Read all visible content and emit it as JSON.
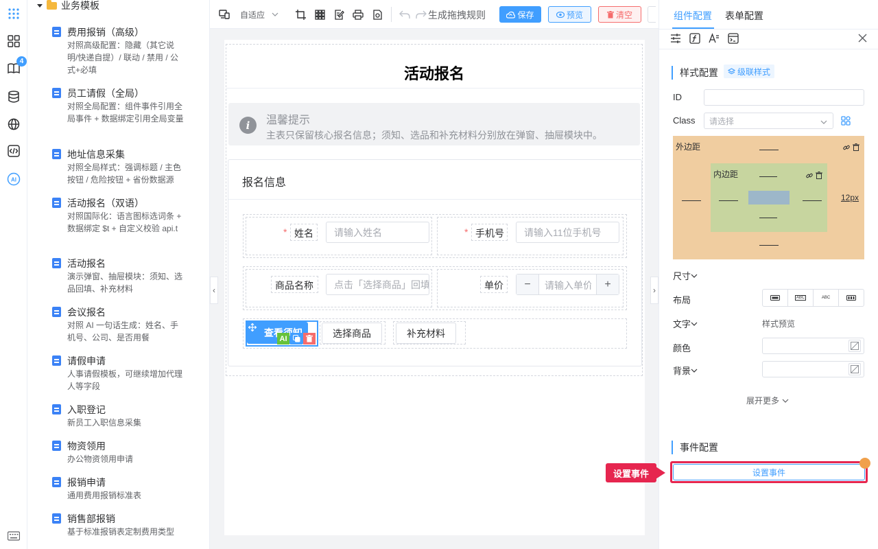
{
  "rail": {
    "icons": [
      "apps-grid-icon",
      "book-icon",
      "database-icon",
      "globe-icon",
      "code-icon",
      "ai-icon",
      "keyboard-icon"
    ],
    "badge": "4"
  },
  "templates": {
    "folder": "业务模板",
    "items": [
      {
        "title": "费用报销（高级）",
        "desc": "对照高级配置：隐藏（其它说明/快递自提）/ 联动 / 禁用 / 公式+必填"
      },
      {
        "title": "员工请假（全局）",
        "desc": "对照全局配置：组件事件引用全局事件 + 数据绑定引用全局变量"
      },
      {
        "title": "地址信息采集",
        "desc": "对照全局样式：强调标题 / 主色按钮 / 危险按钮 + 省份数据源"
      },
      {
        "title": "活动报名（双语）",
        "desc": "对照国际化：语言图标选词条 + 数据绑定 $t + 自定义校验 api.t"
      },
      {
        "title": "活动报名",
        "desc": "演示弹窗、抽屉模块：须知、选品回填、补充材料"
      },
      {
        "title": "会议报名",
        "desc": "对照 AI 一句话生成：姓名、手机号、公司、是否用餐"
      },
      {
        "title": "请假申请",
        "desc": "人事请假模板，可继续增加代理人等字段"
      },
      {
        "title": "入职登记",
        "desc": "新员工入职信息采集"
      },
      {
        "title": "物资领用",
        "desc": "办公物资领用申请"
      },
      {
        "title": "报销申请",
        "desc": "通用费用报销标准表"
      },
      {
        "title": "销售部报销",
        "desc": "基于标准报销表定制费用类型"
      }
    ]
  },
  "toolbar": {
    "adaptive": "自适应",
    "drag_rule": "生成拖拽规则",
    "save": "保存",
    "preview": "预览",
    "clear": "清空"
  },
  "form": {
    "title": "活动报名",
    "tip_title": "温馨提示",
    "tip_text": "主表只保留核心报名信息；须知、选品和补充材料分别放在弹窗、抽屉模块中。",
    "section": "报名信息",
    "name_label": "姓名",
    "name_placeholder": "请输入姓名",
    "phone_label": "手机号",
    "phone_placeholder": "请输入11位手机号",
    "product_label": "商品名称",
    "product_placeholder": "点击「选择商品」回填",
    "price_label": "单价",
    "price_placeholder": "请输入单价",
    "btn_notice": "查看须知",
    "btn_select": "选择商品",
    "btn_material": "补充材料",
    "minus": "−",
    "plus": "+",
    "ai": "AI"
  },
  "panel": {
    "tab_component": "组件配置",
    "tab_form": "表单配置",
    "style_title": "样式配置",
    "cascade": "级联样式",
    "id_label": "ID",
    "class_label": "Class",
    "class_placeholder": "请选择",
    "margin_label": "外边距",
    "padding_label": "内边距",
    "margin_right_value": "12px",
    "size_label": "尺寸",
    "layout_label": "布局",
    "text_label": "文字",
    "text_preview": "样式预览",
    "color_label": "颜色",
    "bg_label": "背景",
    "expand_more": "展开更多",
    "event_title": "事件配置",
    "event_button": "设置事件",
    "event_callout": "设置事件",
    "layout_opts": [
      "▬",
      "ABC",
      "ABC",
      "▮▮"
    ]
  },
  "colors": {
    "primary": "#409eff",
    "danger": "#f56c6c",
    "margin_bg": "#f0cda0",
    "padding_bg": "#c7d59f",
    "content_bg": "#9db7c9",
    "callout": "#e6264f"
  }
}
